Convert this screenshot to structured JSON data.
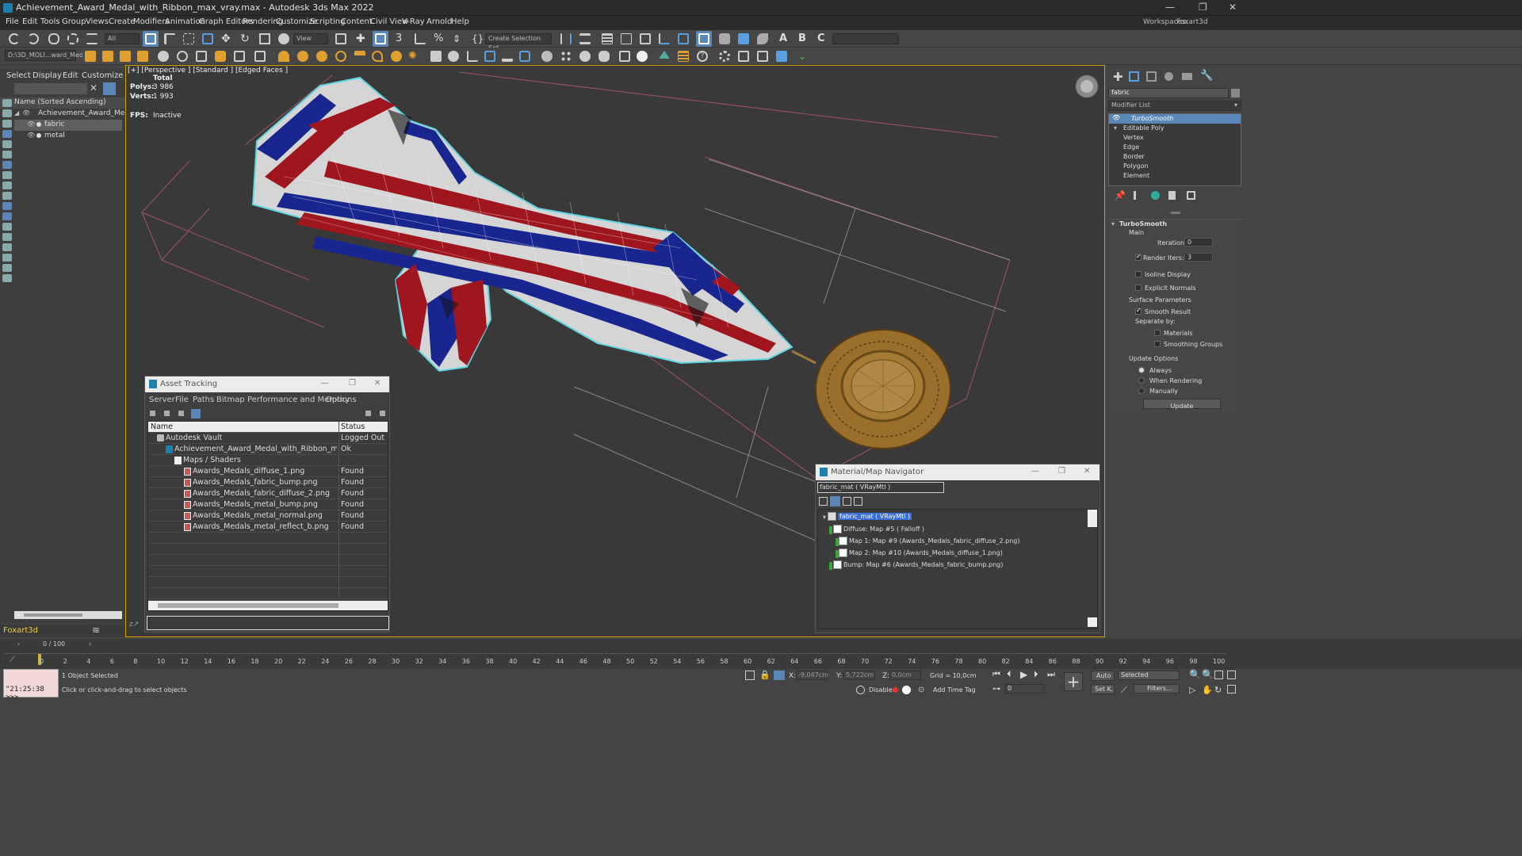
{
  "window": {
    "title": "Achievement_Award_Medal_with_Ribbon_max_vray.max - Autodesk 3ds Max 2022",
    "minimize": "—",
    "maximize": "❐",
    "close": "✕"
  },
  "menu": {
    "items": [
      "File",
      "Edit",
      "Tools",
      "Group",
      "Views",
      "Create",
      "Modifiers",
      "Animation",
      "Graph Editors",
      "Rendering",
      "Customize",
      "Scripting",
      "Content",
      "Civil View",
      "V-Ray",
      "Arnold",
      "Help"
    ],
    "workspaces_label": "Workspaces:",
    "workspace_value": "Foxart3d"
  },
  "toolbar": {
    "selection_filter": "All",
    "ref_coord": "View",
    "selection_set": "Create Selection Set",
    "path_field": "D:\\3D_MOLI...ward_Meda"
  },
  "scene_explorer": {
    "tabs": [
      "Select",
      "Display",
      "Edit",
      "Customize"
    ],
    "column_header": "Name (Sorted Ascending)",
    "items": [
      {
        "label": "Achievement_Award_Medal_wi"
      },
      {
        "label": "fabric"
      },
      {
        "label": "metal"
      }
    ],
    "layer": "Foxart3d",
    "frame": "0 / 100"
  },
  "viewport": {
    "label": "[+] [Perspective ] [Standard ] [Edged Faces ]",
    "stats": {
      "total": "Total",
      "polys_label": "Polys:",
      "polys": "3 986",
      "verts_label": "Verts:",
      "verts": "1 993",
      "fps_label": "FPS:",
      "fps": "Inactive"
    },
    "ribbon_colors": {
      "red": "#a0161e",
      "white": "#d8d8d8",
      "blue": "#1a2690",
      "outline": "#5fd5e0"
    },
    "medal_color": "#9a6f2c"
  },
  "asset_tracking": {
    "title": "Asset Tracking",
    "menu": [
      "Server",
      "File",
      "Paths",
      "Bitmap Performance and Memory",
      "Options"
    ],
    "col_name": "Name",
    "col_status": "Status",
    "rows": [
      {
        "name": "Autodesk Vault",
        "status": "Logged Out (..."
      },
      {
        "name": "Achievement_Award_Medal_with_Ribbon_max_vray....",
        "status": "Ok"
      },
      {
        "name": "Maps / Shaders",
        "status": ""
      },
      {
        "name": "Awards_Medals_diffuse_1.png",
        "status": "Found"
      },
      {
        "name": "Awards_Medals_fabric_bump.png",
        "status": "Found"
      },
      {
        "name": "Awards_Medals_fabric_diffuse_2.png",
        "status": "Found"
      },
      {
        "name": "Awards_Medals_metal_bump.png",
        "status": "Found"
      },
      {
        "name": "Awards_Medals_metal_normal.png",
        "status": "Found"
      },
      {
        "name": "Awards_Medals_metal_reflect_b.png",
        "status": "Found"
      }
    ]
  },
  "material_navigator": {
    "title": "Material/Map Navigator",
    "field": "fabric_mat  ( VRayMtl )",
    "root": "fabric_mat  ( VRayMtl )",
    "nodes": [
      "Diffuse: Map #5  ( Falloff )",
      "Map 1: Map #9 (Awards_Medals_fabric_diffuse_2.png)",
      "Map 2: Map #10 (Awards_Medals_diffuse_1.png)",
      "Bump: Map #6 (Awards_Medals_fabric_bump.png)"
    ]
  },
  "command_panel": {
    "name_field": "fabric",
    "modifier_list": "Modifier List",
    "stack": [
      "TurboSmooth",
      "Editable Poly",
      "Vertex",
      "Edge",
      "Border",
      "Polygon",
      "Element"
    ],
    "rollout": "TurboSmooth",
    "main": "Main",
    "iterations_label": "Iterations:",
    "iterations": "0",
    "render_iters_label": "Render Iters:",
    "render_iters": "3",
    "isoline": "Isoline Display",
    "explicit_normals": "Explicit Normals",
    "surface_params": "Surface Parameters",
    "smooth_result": "Smooth Result",
    "separate_by": "Separate by:",
    "materials": "Materials",
    "smoothing_groups": "Smoothing Groups",
    "update_options": "Update Options",
    "always": "Always",
    "when_rendering": "When Rendering",
    "manually": "Manually",
    "update_btn": "Update"
  },
  "timeline": {
    "ticks": [
      "0",
      "2",
      "4",
      "6",
      "8",
      "10",
      "12",
      "14",
      "16",
      "18",
      "20",
      "22",
      "24",
      "26",
      "28",
      "30",
      "32",
      "34",
      "36",
      "38",
      "40",
      "42",
      "44",
      "46",
      "48",
      "50",
      "52",
      "54",
      "56",
      "58",
      "60",
      "62",
      "64",
      "66",
      "68",
      "70",
      "72",
      "74",
      "76",
      "78",
      "80",
      "82",
      "84",
      "86",
      "88",
      "90",
      "92",
      "94",
      "96",
      "98",
      "100"
    ]
  },
  "status": {
    "maxscript": "\"21:25:38 >>>",
    "selected": "1 Object Selected",
    "prompt": "Click or click-and-drag to select objects",
    "x_label": "X:",
    "x": "-9,047cm",
    "y_label": "Y:",
    "y": "5,722cm",
    "z_label": "Z:",
    "z": "0,0cm",
    "grid": "Grid = 10,0cm",
    "disabled": "Disabled:",
    "add_time_tag": "Add Time Tag",
    "auto": "Auto",
    "selected_dd": "Selected",
    "set_k": "Set K.",
    "filters": "Filters...",
    "frame_field": "0"
  }
}
